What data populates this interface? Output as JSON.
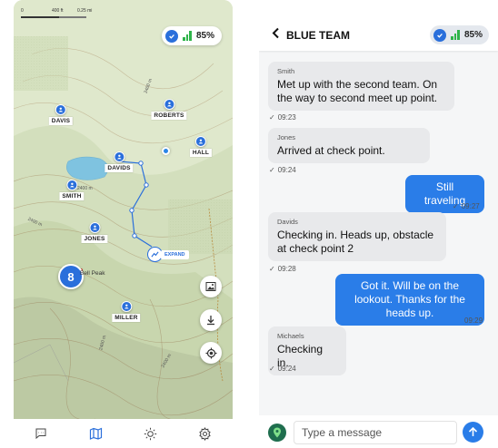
{
  "map": {
    "scale": {
      "left": "0",
      "mid": "400 ft",
      "right": "0.25 mi"
    },
    "status": {
      "battery": "85%",
      "check_icon": "check-circle-icon",
      "signal_icon": "signal-bars-icon"
    },
    "contours": [
      "2400 m",
      "2400 m",
      "2400 m",
      "2400 m",
      "2400 m"
    ],
    "team_members": [
      "DAVIS",
      "ROBERTS",
      "HALL",
      "DAVIDS",
      "SMITH",
      "JONES",
      "MILLER"
    ],
    "expand_label": "EXPAND",
    "cluster_count": "8",
    "peak_label": "Bell Peak",
    "buttons": [
      "image-layer-icon",
      "download-icon",
      "locate-icon"
    ]
  },
  "nav": {
    "items": [
      "chat-icon",
      "map-icon",
      "weather-icon",
      "settings-icon"
    ],
    "active_color": "#2a6fdb"
  },
  "chat": {
    "header": {
      "title": "BLUE TEAM",
      "battery": "85%"
    },
    "messages": [
      {
        "direction": "in",
        "sender": "Smith",
        "text": "Met up with the second team. On the way to second meet up point.",
        "time": "09:23"
      },
      {
        "direction": "in",
        "sender": "Jones",
        "text": "Arrived at check point.",
        "time": "09:24"
      },
      {
        "direction": "out",
        "text": "Still traveling",
        "time": "09:27"
      },
      {
        "direction": "in",
        "sender": "Davids",
        "text": "Checking in. Heads up, obstacle at check point 2",
        "time": "09:28"
      },
      {
        "direction": "out",
        "text": "Got it. Will be on the lookout. Thanks for the heads up.",
        "time": "09:29"
      },
      {
        "direction": "in",
        "sender": "Michaels",
        "text": "Checking in.",
        "time": "09:24"
      }
    ],
    "composer": {
      "placeholder": "Type a message"
    }
  },
  "colors": {
    "accent": "#2a6fdb",
    "bubble_out": "#2a7de8",
    "bubble_in": "#e8e9eb",
    "signal": "#2fb44a",
    "location_button": "#1f6e4e"
  }
}
